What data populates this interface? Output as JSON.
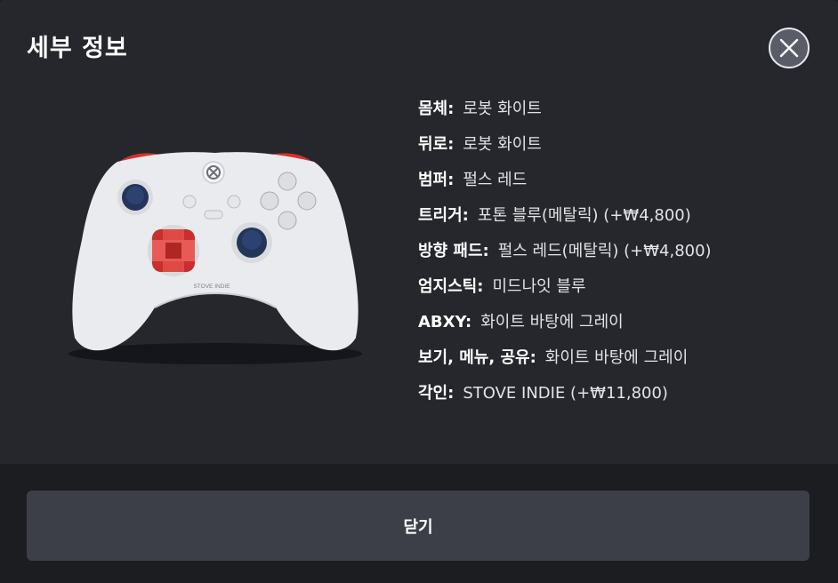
{
  "dialog": {
    "title": "세부 정보",
    "close_label": "닫기"
  },
  "product": {
    "engraving_text": "STOVE INDIE",
    "image_description_icon": "controller-icon"
  },
  "specs": [
    {
      "key": "몸체:",
      "value": "로봇 화이트"
    },
    {
      "key": "뒤로:",
      "value": "로봇 화이트"
    },
    {
      "key": "범퍼:",
      "value": "펄스 레드"
    },
    {
      "key": "트리거:",
      "value": "포톤 블루(메탈릭) (+₩4,800)"
    },
    {
      "key": "방향 패드:",
      "value": "펄스 레드(메탈릭) (+₩4,800)"
    },
    {
      "key": "엄지스틱:",
      "value": "미드나잇 블루"
    },
    {
      "key": "ABXY:",
      "value": "화이트 바탕에 그레이"
    },
    {
      "key": "보기, 메뉴, 공유:",
      "value": "화이트 바탕에 그레이"
    },
    {
      "key": "각인:",
      "value": "STOVE INDIE (+₩11,800)"
    }
  ],
  "colors": {
    "background": "#26272c",
    "button": "#3d3f48",
    "body_white": "#e9ebee",
    "bumper_red": "#d8322f",
    "thumbstick_blue": "#24355a",
    "dpad_red": "#c8302d"
  }
}
